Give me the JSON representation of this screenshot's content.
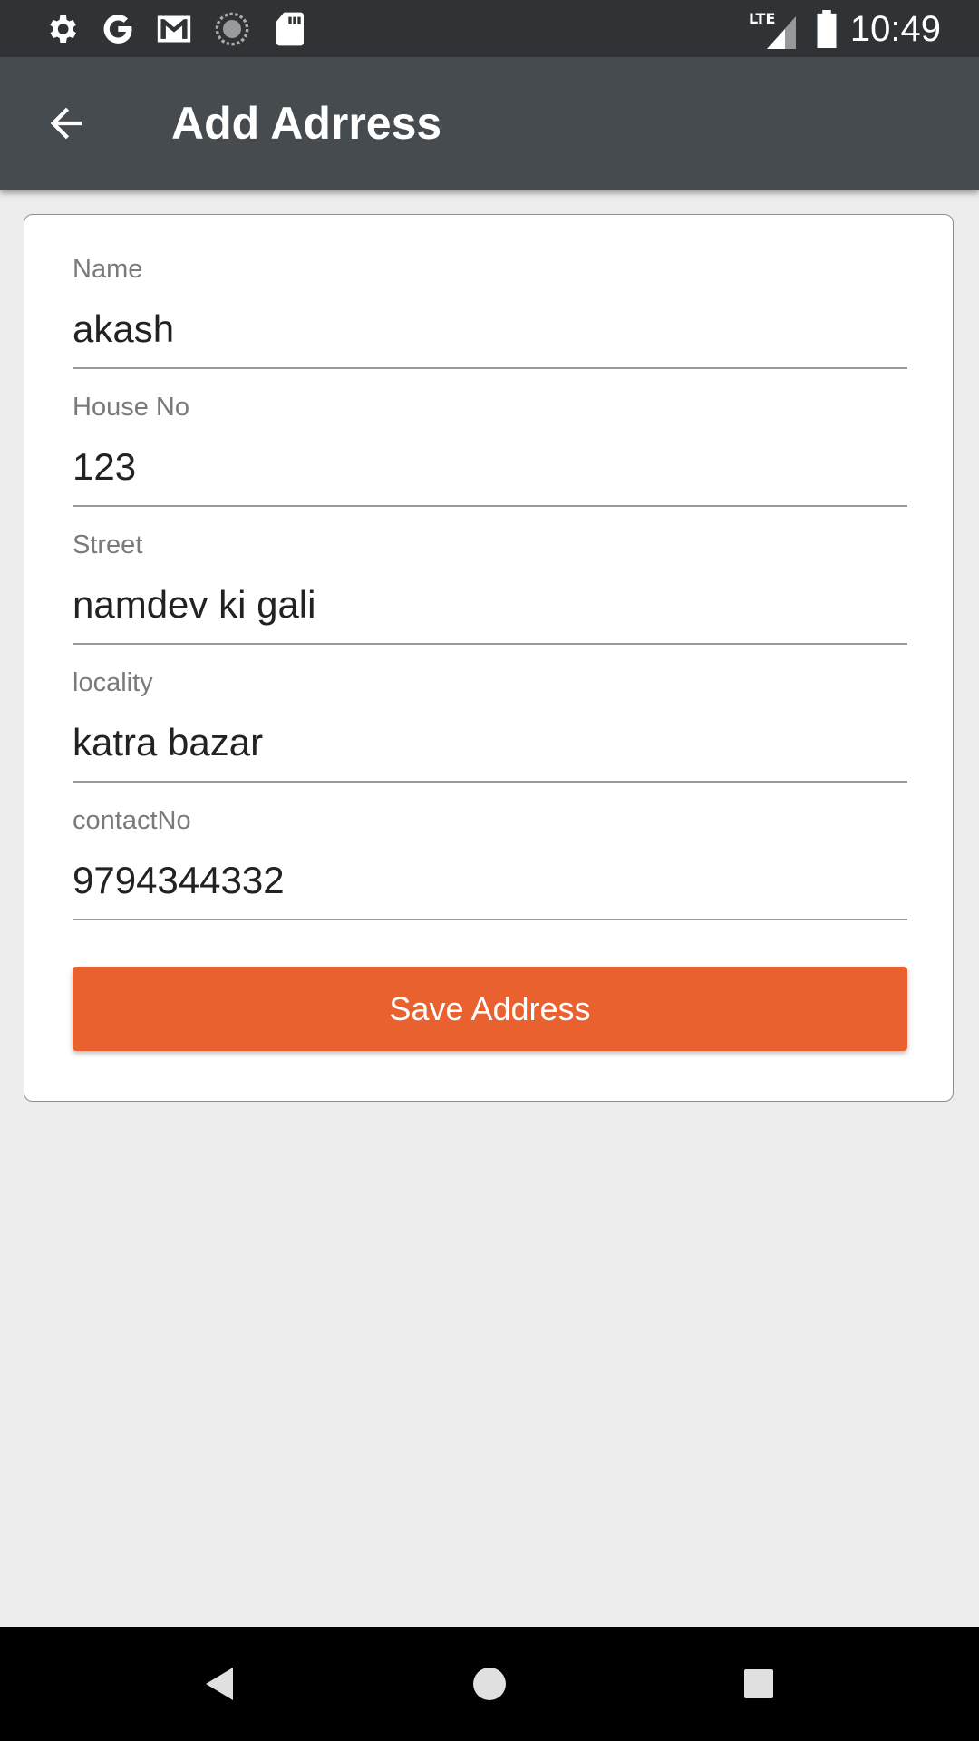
{
  "status_bar": {
    "time": "10:49",
    "network": "LTE",
    "icons": [
      "settings-icon",
      "google-icon",
      "gmail-icon",
      "sync-icon",
      "sd-card-icon",
      "signal-icon",
      "battery-icon"
    ]
  },
  "app_bar": {
    "title": "Add Adrress",
    "back_icon": "arrow-back-icon"
  },
  "form": {
    "fields": [
      {
        "label": "Name",
        "value": "akash"
      },
      {
        "label": "House No",
        "value": "123"
      },
      {
        "label": "Street",
        "value": "namdev ki gali"
      },
      {
        "label": "locality",
        "value": "katra bazar"
      },
      {
        "label": "contactNo",
        "value": "9794344332"
      }
    ],
    "save_label": "Save Address"
  },
  "colors": {
    "status_bar": "#2f3336",
    "app_bar": "#454b4f",
    "accent": "#e8612f",
    "background": "#ededed"
  },
  "nav_bar": {
    "icons": [
      "nav-back-icon",
      "nav-home-icon",
      "nav-recents-icon"
    ]
  }
}
